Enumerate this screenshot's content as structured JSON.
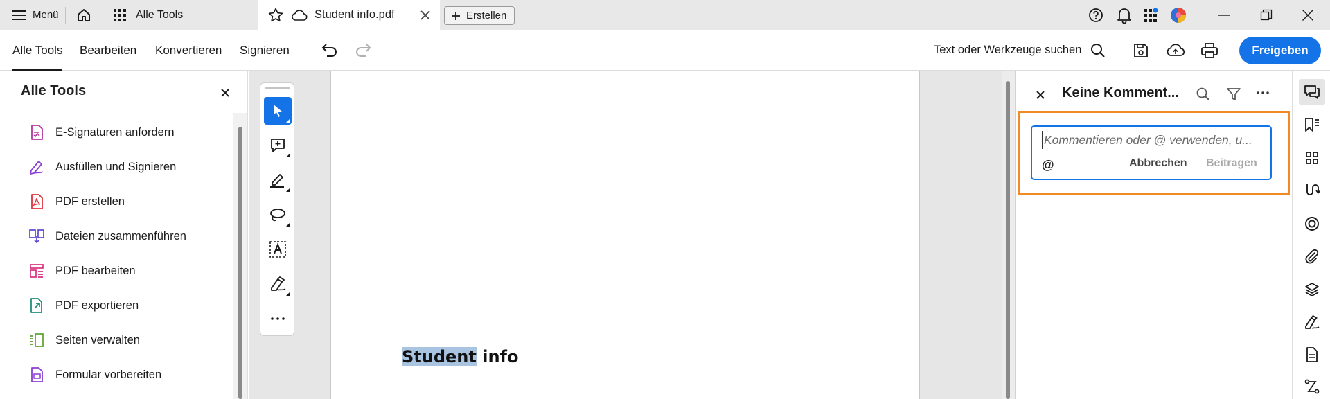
{
  "titlebar": {
    "menu_label": "Menü",
    "all_tools_tab": "Alle Tools",
    "doc_tab": "Student info.pdf",
    "new_label": "Erstellen"
  },
  "toolbar": {
    "tabs": [
      "Alle Tools",
      "Bearbeiten",
      "Konvertieren",
      "Signieren"
    ],
    "active_tab": "Alle Tools",
    "search_label": "Text oder Werkzeuge suchen",
    "share_label": "Freigeben"
  },
  "left_panel": {
    "title": "Alle Tools",
    "items": [
      {
        "label": "E-Signaturen anfordern",
        "icon": "esign-icon",
        "color": "#b3379e"
      },
      {
        "label": "Ausfüllen und Signieren",
        "icon": "fill-sign-icon",
        "color": "#8a3fd1"
      },
      {
        "label": "PDF erstellen",
        "icon": "create-pdf-icon",
        "color": "#e0323b"
      },
      {
        "label": "Dateien zusammenführen",
        "icon": "combine-files-icon",
        "color": "#5b47d6"
      },
      {
        "label": "PDF bearbeiten",
        "icon": "edit-pdf-icon",
        "color": "#d8317e"
      },
      {
        "label": "PDF exportieren",
        "icon": "export-pdf-icon",
        "color": "#1f8f7a"
      },
      {
        "label": "Seiten verwalten",
        "icon": "organize-pages-icon",
        "color": "#5aa02c"
      },
      {
        "label": "Formular vorbereiten",
        "icon": "prepare-form-icon",
        "color": "#8a3fd1"
      }
    ]
  },
  "document": {
    "text_highlighted": "Student",
    "text_rest": " info"
  },
  "comments": {
    "title": "Keine Komment...",
    "placeholder": "Kommentieren oder @ verwenden, u...",
    "at_label": "@",
    "cancel_label": "Abbrechen",
    "post_label": "Beitragen"
  },
  "colors": {
    "accent": "#1473e6",
    "highlight_frame": "#f08a24",
    "text_highlight": "#a9c4e0"
  }
}
